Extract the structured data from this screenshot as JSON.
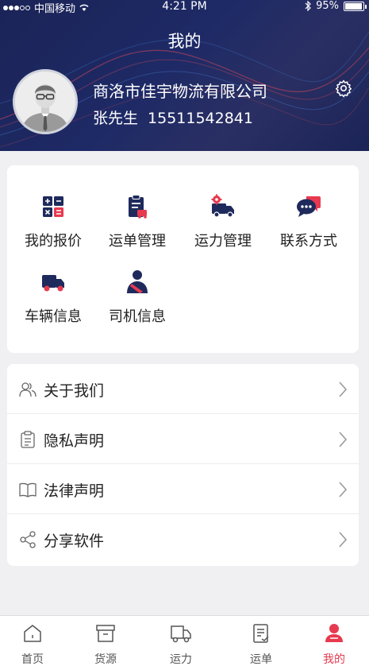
{
  "status_bar": {
    "carrier": "中国移动",
    "time": "4:21 PM",
    "battery": "95%"
  },
  "header": {
    "title": "我的",
    "company": "商洛市佳宇物流有限公司",
    "user_name": "张先生",
    "phone": "15511542841"
  },
  "grid": {
    "items": [
      {
        "label": "我的报价",
        "icon": "calculator-icon"
      },
      {
        "label": "运单管理",
        "icon": "waybill-icon"
      },
      {
        "label": "运力管理",
        "icon": "truck-gear-icon"
      },
      {
        "label": "联系方式",
        "icon": "chat-icon"
      },
      {
        "label": "车辆信息",
        "icon": "truck-icon"
      },
      {
        "label": "司机信息",
        "icon": "driver-icon"
      }
    ]
  },
  "menu": {
    "items": [
      {
        "label": "关于我们",
        "icon": "people-icon"
      },
      {
        "label": "隐私声明",
        "icon": "clipboard-icon"
      },
      {
        "label": "法律声明",
        "icon": "book-icon"
      },
      {
        "label": "分享软件",
        "icon": "share-icon"
      }
    ]
  },
  "tabbar": {
    "items": [
      {
        "label": "首页",
        "icon": "home-icon"
      },
      {
        "label": "货源",
        "icon": "box-icon"
      },
      {
        "label": "运力",
        "icon": "truck-icon"
      },
      {
        "label": "运单",
        "icon": "document-icon"
      },
      {
        "label": "我的",
        "icon": "profile-icon"
      }
    ],
    "active_index": 4
  },
  "colors": {
    "header_bg": "#1b2457",
    "accent_red": "#e73a4f",
    "icon_navy": "#1f2a5c"
  }
}
